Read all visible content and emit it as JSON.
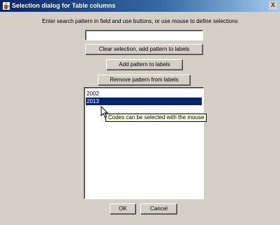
{
  "window": {
    "title": "Selection dialog for Table columns",
    "close_glyph": "X",
    "title_icon": "java-cup-icon"
  },
  "instruction": "Enter search pattern in field and use buttons, or use mouse to define selections",
  "search": {
    "value": "",
    "placeholder": ""
  },
  "buttons": {
    "clear": "Clear selection, add pattern to labels",
    "add": "Add pattern to labels",
    "remove": "Remove pattern from labels",
    "ok": "OK",
    "cancel": "Cancel"
  },
  "list": {
    "items": [
      {
        "label": "2002",
        "selected": false
      },
      {
        "label": "2013",
        "selected": true
      }
    ]
  },
  "tooltip": "Codes can be selected with the mouse",
  "colors": {
    "title_start": "#0a246a",
    "title_end": "#a6caf0",
    "selection": "#0a246a",
    "window_bg": "#d4d0c8",
    "tooltip_bg": "#ffffe1"
  }
}
